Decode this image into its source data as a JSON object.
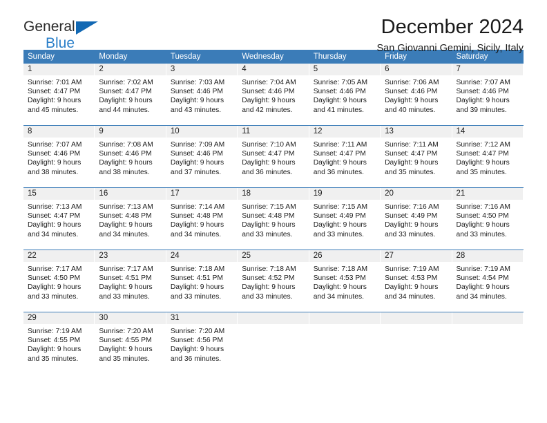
{
  "brand": {
    "line1": "General",
    "line2": "Blue",
    "triangle_color": "#1268b3",
    "line2_color": "#2a7fc9"
  },
  "header": {
    "title": "December 2024",
    "subtitle": "San Giovanni Gemini, Sicily, Italy"
  },
  "theme": {
    "header_bg": "#3b7cb8",
    "header_text": "#ffffff",
    "daynum_bg": "#f0f0f0",
    "cell_bg": "#ffffff",
    "grid_line": "#3b7cb8"
  },
  "weekdays": [
    "Sunday",
    "Monday",
    "Tuesday",
    "Wednesday",
    "Thursday",
    "Friday",
    "Saturday"
  ],
  "weeks": [
    [
      {
        "day": "1",
        "sunrise": "Sunrise: 7:01 AM",
        "sunset": "Sunset: 4:47 PM",
        "daylight1": "Daylight: 9 hours",
        "daylight2": "and 45 minutes."
      },
      {
        "day": "2",
        "sunrise": "Sunrise: 7:02 AM",
        "sunset": "Sunset: 4:47 PM",
        "daylight1": "Daylight: 9 hours",
        "daylight2": "and 44 minutes."
      },
      {
        "day": "3",
        "sunrise": "Sunrise: 7:03 AM",
        "sunset": "Sunset: 4:46 PM",
        "daylight1": "Daylight: 9 hours",
        "daylight2": "and 43 minutes."
      },
      {
        "day": "4",
        "sunrise": "Sunrise: 7:04 AM",
        "sunset": "Sunset: 4:46 PM",
        "daylight1": "Daylight: 9 hours",
        "daylight2": "and 42 minutes."
      },
      {
        "day": "5",
        "sunrise": "Sunrise: 7:05 AM",
        "sunset": "Sunset: 4:46 PM",
        "daylight1": "Daylight: 9 hours",
        "daylight2": "and 41 minutes."
      },
      {
        "day": "6",
        "sunrise": "Sunrise: 7:06 AM",
        "sunset": "Sunset: 4:46 PM",
        "daylight1": "Daylight: 9 hours",
        "daylight2": "and 40 minutes."
      },
      {
        "day": "7",
        "sunrise": "Sunrise: 7:07 AM",
        "sunset": "Sunset: 4:46 PM",
        "daylight1": "Daylight: 9 hours",
        "daylight2": "and 39 minutes."
      }
    ],
    [
      {
        "day": "8",
        "sunrise": "Sunrise: 7:07 AM",
        "sunset": "Sunset: 4:46 PM",
        "daylight1": "Daylight: 9 hours",
        "daylight2": "and 38 minutes."
      },
      {
        "day": "9",
        "sunrise": "Sunrise: 7:08 AM",
        "sunset": "Sunset: 4:46 PM",
        "daylight1": "Daylight: 9 hours",
        "daylight2": "and 38 minutes."
      },
      {
        "day": "10",
        "sunrise": "Sunrise: 7:09 AM",
        "sunset": "Sunset: 4:46 PM",
        "daylight1": "Daylight: 9 hours",
        "daylight2": "and 37 minutes."
      },
      {
        "day": "11",
        "sunrise": "Sunrise: 7:10 AM",
        "sunset": "Sunset: 4:47 PM",
        "daylight1": "Daylight: 9 hours",
        "daylight2": "and 36 minutes."
      },
      {
        "day": "12",
        "sunrise": "Sunrise: 7:11 AM",
        "sunset": "Sunset: 4:47 PM",
        "daylight1": "Daylight: 9 hours",
        "daylight2": "and 36 minutes."
      },
      {
        "day": "13",
        "sunrise": "Sunrise: 7:11 AM",
        "sunset": "Sunset: 4:47 PM",
        "daylight1": "Daylight: 9 hours",
        "daylight2": "and 35 minutes."
      },
      {
        "day": "14",
        "sunrise": "Sunrise: 7:12 AM",
        "sunset": "Sunset: 4:47 PM",
        "daylight1": "Daylight: 9 hours",
        "daylight2": "and 35 minutes."
      }
    ],
    [
      {
        "day": "15",
        "sunrise": "Sunrise: 7:13 AM",
        "sunset": "Sunset: 4:47 PM",
        "daylight1": "Daylight: 9 hours",
        "daylight2": "and 34 minutes."
      },
      {
        "day": "16",
        "sunrise": "Sunrise: 7:13 AM",
        "sunset": "Sunset: 4:48 PM",
        "daylight1": "Daylight: 9 hours",
        "daylight2": "and 34 minutes."
      },
      {
        "day": "17",
        "sunrise": "Sunrise: 7:14 AM",
        "sunset": "Sunset: 4:48 PM",
        "daylight1": "Daylight: 9 hours",
        "daylight2": "and 34 minutes."
      },
      {
        "day": "18",
        "sunrise": "Sunrise: 7:15 AM",
        "sunset": "Sunset: 4:48 PM",
        "daylight1": "Daylight: 9 hours",
        "daylight2": "and 33 minutes."
      },
      {
        "day": "19",
        "sunrise": "Sunrise: 7:15 AM",
        "sunset": "Sunset: 4:49 PM",
        "daylight1": "Daylight: 9 hours",
        "daylight2": "and 33 minutes."
      },
      {
        "day": "20",
        "sunrise": "Sunrise: 7:16 AM",
        "sunset": "Sunset: 4:49 PM",
        "daylight1": "Daylight: 9 hours",
        "daylight2": "and 33 minutes."
      },
      {
        "day": "21",
        "sunrise": "Sunrise: 7:16 AM",
        "sunset": "Sunset: 4:50 PM",
        "daylight1": "Daylight: 9 hours",
        "daylight2": "and 33 minutes."
      }
    ],
    [
      {
        "day": "22",
        "sunrise": "Sunrise: 7:17 AM",
        "sunset": "Sunset: 4:50 PM",
        "daylight1": "Daylight: 9 hours",
        "daylight2": "and 33 minutes."
      },
      {
        "day": "23",
        "sunrise": "Sunrise: 7:17 AM",
        "sunset": "Sunset: 4:51 PM",
        "daylight1": "Daylight: 9 hours",
        "daylight2": "and 33 minutes."
      },
      {
        "day": "24",
        "sunrise": "Sunrise: 7:18 AM",
        "sunset": "Sunset: 4:51 PM",
        "daylight1": "Daylight: 9 hours",
        "daylight2": "and 33 minutes."
      },
      {
        "day": "25",
        "sunrise": "Sunrise: 7:18 AM",
        "sunset": "Sunset: 4:52 PM",
        "daylight1": "Daylight: 9 hours",
        "daylight2": "and 33 minutes."
      },
      {
        "day": "26",
        "sunrise": "Sunrise: 7:18 AM",
        "sunset": "Sunset: 4:53 PM",
        "daylight1": "Daylight: 9 hours",
        "daylight2": "and 34 minutes."
      },
      {
        "day": "27",
        "sunrise": "Sunrise: 7:19 AM",
        "sunset": "Sunset: 4:53 PM",
        "daylight1": "Daylight: 9 hours",
        "daylight2": "and 34 minutes."
      },
      {
        "day": "28",
        "sunrise": "Sunrise: 7:19 AM",
        "sunset": "Sunset: 4:54 PM",
        "daylight1": "Daylight: 9 hours",
        "daylight2": "and 34 minutes."
      }
    ],
    [
      {
        "day": "29",
        "sunrise": "Sunrise: 7:19 AM",
        "sunset": "Sunset: 4:55 PM",
        "daylight1": "Daylight: 9 hours",
        "daylight2": "and 35 minutes."
      },
      {
        "day": "30",
        "sunrise": "Sunrise: 7:20 AM",
        "sunset": "Sunset: 4:55 PM",
        "daylight1": "Daylight: 9 hours",
        "daylight2": "and 35 minutes."
      },
      {
        "day": "31",
        "sunrise": "Sunrise: 7:20 AM",
        "sunset": "Sunset: 4:56 PM",
        "daylight1": "Daylight: 9 hours",
        "daylight2": "and 36 minutes."
      },
      {
        "day": "",
        "sunrise": "",
        "sunset": "",
        "daylight1": "",
        "daylight2": ""
      },
      {
        "day": "",
        "sunrise": "",
        "sunset": "",
        "daylight1": "",
        "daylight2": ""
      },
      {
        "day": "",
        "sunrise": "",
        "sunset": "",
        "daylight1": "",
        "daylight2": ""
      },
      {
        "day": "",
        "sunrise": "",
        "sunset": "",
        "daylight1": "",
        "daylight2": ""
      }
    ]
  ]
}
